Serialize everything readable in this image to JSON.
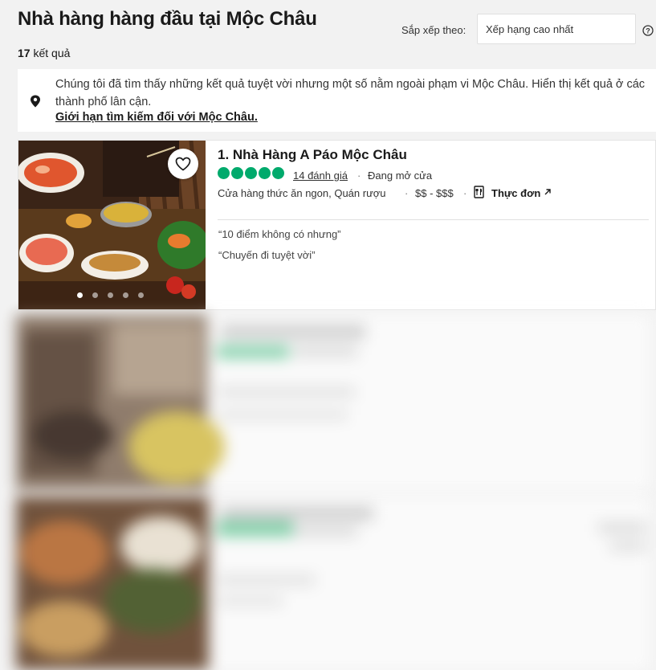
{
  "header": {
    "title": "Nhà hàng hàng đầu tại Mộc Châu",
    "count_number": "17",
    "count_suffix": " kết quả",
    "sort_label": "Sắp xếp theo:",
    "sort_value": "Xếp hạng cao nhất"
  },
  "notice": {
    "message": "Chúng tôi đã tìm thấy những kết quả tuyệt vời nhưng một số nằm ngoài phạm vi Mộc Châu. Hiển thị kết quả ở các thành phố lân cận.",
    "limit_link": "Giới hạn tìm kiếm đối với Mộc Châu."
  },
  "restaurant": {
    "name": "1. Nhà Hàng A Páo Mộc Châu",
    "rating_bubbles": 5,
    "reviews": "14 đánh giá",
    "status": "Đang mở cửa",
    "cuisine": "Cửa hàng thức ăn ngon, Quán rượu",
    "price": "$$ - $$$",
    "menu_label": "Thực đơn",
    "quotes": [
      "“10 điểm không có nhưng”",
      "“Chuyến đi tuyệt vời”"
    ],
    "photo_count": 5,
    "active_photo": 1
  },
  "colors": {
    "rating_green": "#00aa6c",
    "background": "#f2f2f2"
  }
}
